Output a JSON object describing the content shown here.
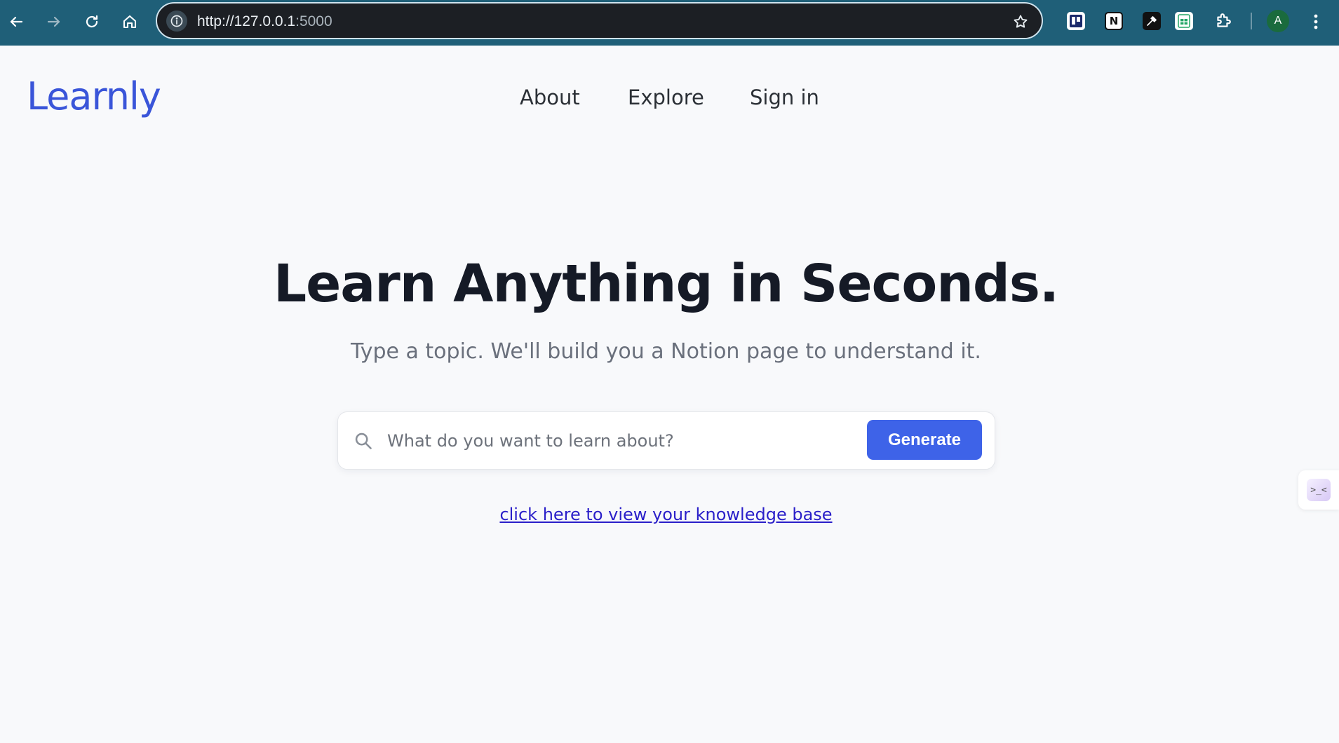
{
  "browser": {
    "url_host": "http://127.0.0.1",
    "url_port": ":5000",
    "avatar_letter": "A",
    "chrome_color": "#1f5f78"
  },
  "header": {
    "logo": "Learnly",
    "nav": {
      "about": "About",
      "explore": "Explore",
      "sign_in": "Sign in"
    }
  },
  "hero": {
    "title": "Learn Anything in Seconds.",
    "subtitle": "Type a topic. We'll build you a Notion page to understand it."
  },
  "search": {
    "placeholder": "What do you want to learn about?",
    "value": "",
    "button_label": "Generate"
  },
  "links": {
    "knowledge_base": "click here to view your knowledge base"
  },
  "side_widget": {
    "glyph": ">_<"
  },
  "colors": {
    "accent": "#3e63e8",
    "logo": "#3a55d9",
    "link": "#2a1fc9"
  },
  "icons": [
    "back-arrow-icon",
    "forward-arrow-icon",
    "reload-icon",
    "home-icon",
    "site-info-icon",
    "star-icon",
    "extension-puzzle-icon",
    "more-vertical-icon",
    "search-icon"
  ]
}
